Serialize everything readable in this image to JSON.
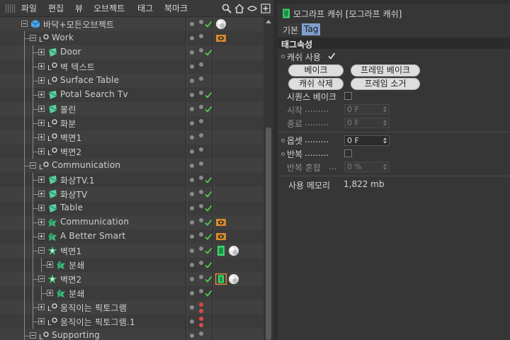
{
  "menubar": {
    "items": [
      "파일",
      "편집",
      "뷰",
      "오브젝트",
      "태그",
      "북마크"
    ]
  },
  "tree": [
    {
      "name": "바닥+모든오브젝트",
      "icon": "cube-object-icon",
      "depth": 0,
      "expand": "minus",
      "dots": [
        "gray",
        "gray"
      ],
      "check": true,
      "tags": [
        "sphere-material-tag-icon"
      ]
    },
    {
      "name": "Work",
      "icon": "null-object-icon",
      "depth": 1,
      "expand": "minus",
      "dots": [
        "gray",
        "gray"
      ],
      "check": false,
      "tags": [
        "display-tag-icon"
      ]
    },
    {
      "name": "Door",
      "icon": "polygon-object-icon",
      "depth": 2,
      "expand": "plus",
      "dots": [
        "gray",
        "gray"
      ],
      "check": true,
      "tags": []
    },
    {
      "name": "벽 텍스트",
      "icon": "null-object-icon",
      "depth": 2,
      "expand": "plus",
      "dots": [
        "gray",
        "gray"
      ],
      "check": false,
      "tags": []
    },
    {
      "name": "Surface Table",
      "icon": "null-object-icon",
      "depth": 2,
      "expand": "plus",
      "dots": [
        "gray",
        "gray"
      ],
      "check": false,
      "tags": []
    },
    {
      "name": "Potal Search Tv",
      "icon": "polygon-object-icon",
      "depth": 2,
      "expand": "plus",
      "dots": [
        "gray",
        "gray"
      ],
      "check": true,
      "tags": []
    },
    {
      "name": "볼린",
      "icon": "polygon-object-icon",
      "depth": 2,
      "expand": "plus",
      "dots": [
        "gray",
        "gray"
      ],
      "check": true,
      "tags": []
    },
    {
      "name": "화분",
      "icon": "null-object-icon",
      "depth": 2,
      "expand": "plus",
      "dots": [
        "gray",
        "gray"
      ],
      "check": false,
      "tags": []
    },
    {
      "name": "벽면1",
      "icon": "null-object-icon",
      "depth": 2,
      "expand": "plus",
      "dots": [
        "gray",
        "gray"
      ],
      "check": false,
      "tags": []
    },
    {
      "name": "벽면2",
      "icon": "null-object-icon",
      "depth": 2,
      "expand": "plus",
      "dots": [
        "gray",
        "gray"
      ],
      "check": false,
      "tags": []
    },
    {
      "name": "Communication",
      "icon": "null-object-icon",
      "depth": 1,
      "expand": "minus",
      "dots": [
        "gray",
        "gray"
      ],
      "check": false,
      "tags": []
    },
    {
      "name": "화상TV.1",
      "icon": "polygon-object-icon",
      "depth": 2,
      "expand": "plus",
      "dots": [
        "gray",
        "gray"
      ],
      "check": true,
      "tags": []
    },
    {
      "name": "화상TV",
      "icon": "polygon-object-icon",
      "depth": 2,
      "expand": "plus",
      "dots": [
        "gray",
        "gray"
      ],
      "check": true,
      "tags": []
    },
    {
      "name": "Table",
      "icon": "polygon-object-icon",
      "depth": 2,
      "expand": "plus",
      "dots": [
        "gray",
        "gray"
      ],
      "check": true,
      "tags": []
    },
    {
      "name": "Communication",
      "icon": "fracture-object-icon",
      "depth": 2,
      "expand": "plus",
      "dots": [
        "gray",
        "gray"
      ],
      "check": true,
      "tags": [
        "display-tag-icon"
      ]
    },
    {
      "name": "A Better Smart",
      "icon": "fracture-object-icon",
      "depth": 2,
      "expand": "plus",
      "dots": [
        "gray",
        "gray"
      ],
      "check": true,
      "tags": [
        "display-tag-icon"
      ]
    },
    {
      "name": "벽면1",
      "icon": "cloner-object-icon",
      "depth": 2,
      "expand": "minus",
      "dots": [
        "gray",
        "gray"
      ],
      "check": true,
      "tags": [
        "mograph-cache-tag-icon",
        "sphere-material-tag-icon"
      ]
    },
    {
      "name": "분쇄",
      "icon": "fracture-object-icon",
      "depth": 3,
      "expand": "plus",
      "dots": [
        "gray",
        "gray"
      ],
      "check": true,
      "tags": []
    },
    {
      "name": "벽면2",
      "icon": "cloner-object-icon",
      "depth": 2,
      "expand": "minus",
      "dots": [
        "gray",
        "gray"
      ],
      "check": true,
      "tags": [
        "mograph-cache-tag-selected-icon",
        "sphere-material-tag-icon"
      ]
    },
    {
      "name": "분쇄",
      "icon": "fracture-object-icon",
      "depth": 3,
      "expand": "plus",
      "dots": [
        "gray",
        "gray"
      ],
      "check": true,
      "tags": []
    },
    {
      "name": "움직이는 픽토그램",
      "icon": "null-object-icon",
      "depth": 2,
      "expand": "plus",
      "dots": [
        "gray",
        "red"
      ],
      "check": false,
      "tags": []
    },
    {
      "name": "움직이는 픽토그램.1",
      "icon": "null-object-icon",
      "depth": 2,
      "expand": "plus",
      "dots": [
        "gray",
        "red"
      ],
      "check": false,
      "tags": []
    },
    {
      "name": "Supporting",
      "icon": "null-object-icon",
      "depth": 1,
      "expand": "minus",
      "dots": [
        "gray",
        "gray"
      ],
      "check": false,
      "tags": []
    }
  ],
  "attributes": {
    "title": "모그라프 캐쉬 [모그라프 캐쉬]",
    "tabs": {
      "basic": "기본",
      "tag": "Tag"
    },
    "section": "태그속성",
    "use_cache": {
      "label": "캐쉬 사용",
      "checked": true
    },
    "buttons": {
      "bake": "베이크",
      "frame_bake": "프레임 베이크",
      "delete_cache": "캐쉬 삭제",
      "frame_clear": "프레임 소거"
    },
    "sequence_bake": {
      "label": "시퀀스 베이크",
      "checked": false
    },
    "start": {
      "label": "시작",
      "value": "0 F"
    },
    "end": {
      "label": "종료",
      "value": "0 F"
    },
    "offset": {
      "label": "옵셋",
      "value": "0 F"
    },
    "loop": {
      "label": "반복",
      "checked": false
    },
    "loop_blend": {
      "label": "반복 혼합",
      "value": "0 %"
    },
    "memory": {
      "label": "사용 메모리",
      "value": "1,822 mb"
    }
  },
  "colors": {
    "check_green": "#55d455",
    "dot_red": "#e04848",
    "active_tab": "#7f9fce",
    "selection_orange": "#e8922a",
    "mograph_green": "#3cd870"
  }
}
